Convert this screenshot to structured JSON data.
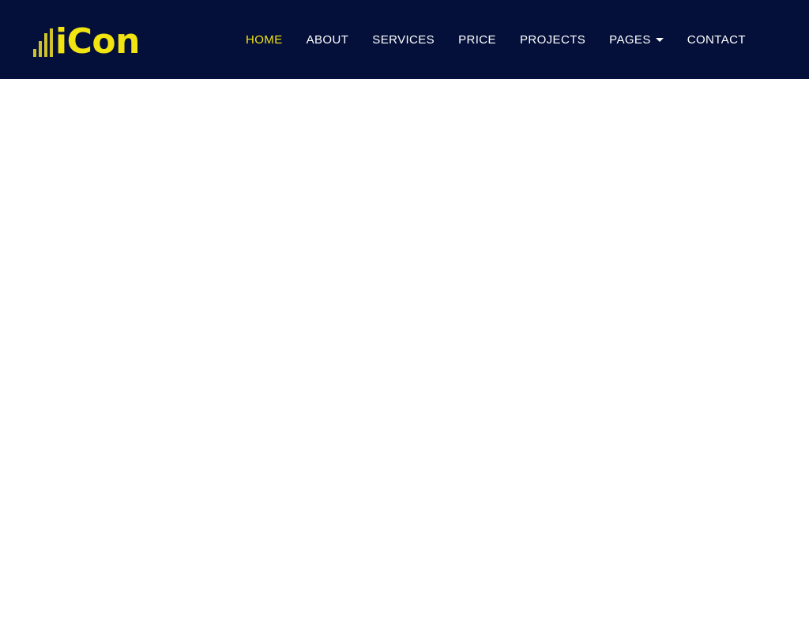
{
  "theme": {
    "header_bg": "#04103a",
    "accent_yellow": "#f2e411",
    "bar_yellow": "#cfc22e",
    "nav_text": "#ffffff",
    "body_bg": "#ffffff"
  },
  "header": {
    "brand": {
      "text": "iCon",
      "bars_icon": "equalizer-bars-icon",
      "bar_count": 4
    },
    "nav": {
      "items": [
        {
          "label": "HOME",
          "active": true,
          "has_dropdown": false
        },
        {
          "label": "ABOUT",
          "active": false,
          "has_dropdown": false
        },
        {
          "label": "SERVICES",
          "active": false,
          "has_dropdown": false
        },
        {
          "label": "PRICE",
          "active": false,
          "has_dropdown": false
        },
        {
          "label": "PROJECTS",
          "active": false,
          "has_dropdown": false
        },
        {
          "label": "PAGES",
          "active": false,
          "has_dropdown": true,
          "dropdown_icon": "caret-down-icon"
        },
        {
          "label": "CONTACT",
          "active": false,
          "has_dropdown": false
        }
      ]
    }
  },
  "main": {
    "content": ""
  }
}
